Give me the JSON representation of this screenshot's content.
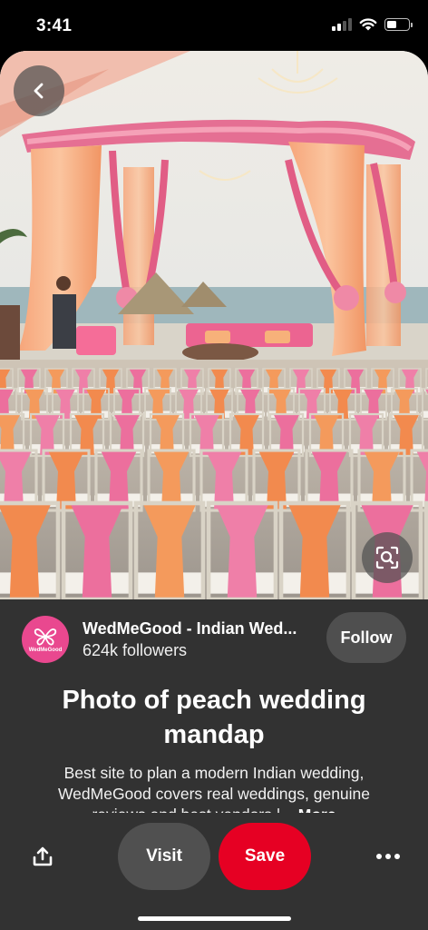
{
  "status_bar": {
    "time": "3:41"
  },
  "pin": {
    "title": "Photo of peach wedding mandap",
    "description": "Best site to plan a modern Indian wedding, WedMeGood covers real weddings, genuine reviews and best vendors |...",
    "more_label": "More"
  },
  "creator": {
    "name": "WedMeGood - Indian Wed...",
    "followers": "624k followers",
    "avatar_text": "WedMeGood",
    "follow_label": "Follow"
  },
  "actions": {
    "visit_label": "Visit",
    "save_label": "Save"
  },
  "colors": {
    "save_red": "#e60023",
    "avatar_pink": "#e9488f",
    "sheet_background": "#323232",
    "button_gray": "#4f4f4f"
  },
  "icons": {
    "back": "chevron-left-icon",
    "visual_search": "visual-search-icon",
    "share": "share-icon",
    "more": "more-icon",
    "avatar_logo": "butterfly-logo-icon"
  }
}
